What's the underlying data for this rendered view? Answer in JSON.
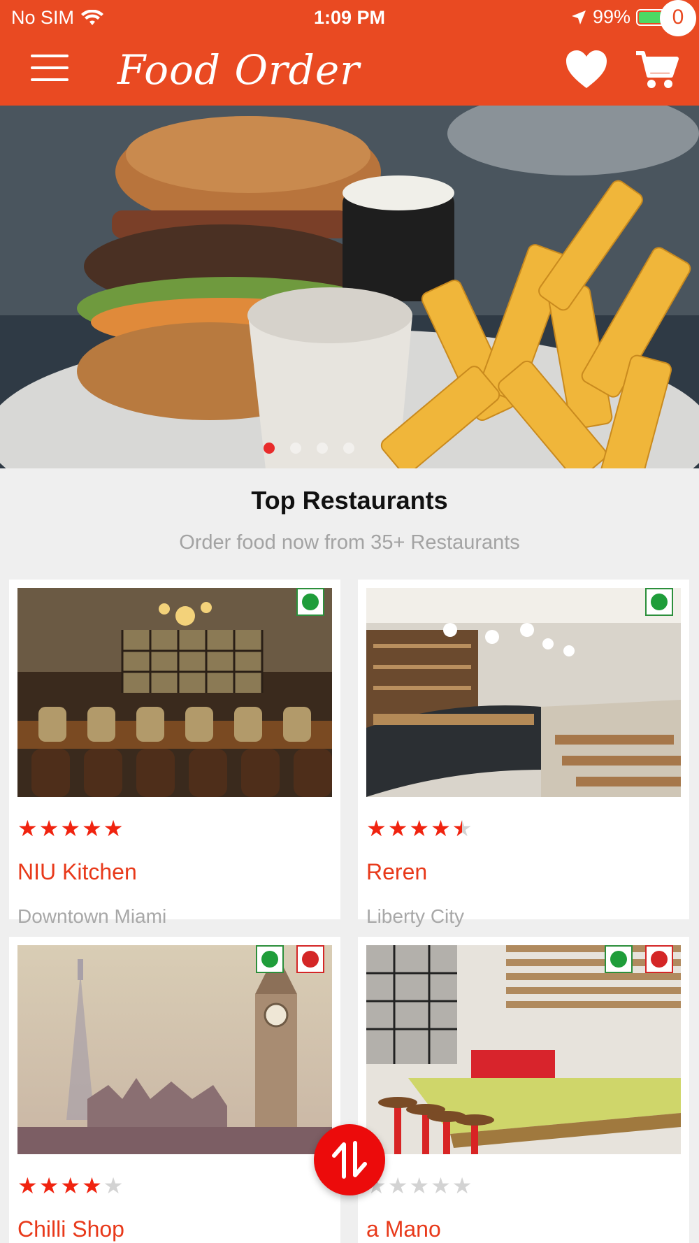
{
  "status_bar": {
    "carrier": "No SIM",
    "time": "1:09 PM",
    "battery": "99%"
  },
  "header": {
    "brand": "Food Order",
    "cart_count": "0",
    "icons": [
      "menu-icon",
      "heart-icon",
      "cart-icon"
    ]
  },
  "hero": {
    "slide_count": 4,
    "active_slide": 1
  },
  "section": {
    "title": "Top Restaurants",
    "subtitle": "Order food now from 35+ Restaurants"
  },
  "restaurants": [
    {
      "name": "NIU Kitchen",
      "area": "Downtown Miami",
      "rating": 5,
      "veg": true,
      "nonveg": false
    },
    {
      "name": "Reren",
      "area": "Liberty City",
      "rating": 4.5,
      "veg": true,
      "nonveg": false
    },
    {
      "name": "Chilli Shop",
      "area": "",
      "rating": 4,
      "veg": true,
      "nonveg": true
    },
    {
      "name": "a Mano",
      "area": "",
      "rating": 0,
      "veg": true,
      "nonveg": true
    }
  ],
  "colors": {
    "brand": "#e94a22",
    "accent": "#e8391a",
    "star": "#f0230f",
    "veg": "#1f9d3a",
    "nonveg": "#d42626"
  }
}
